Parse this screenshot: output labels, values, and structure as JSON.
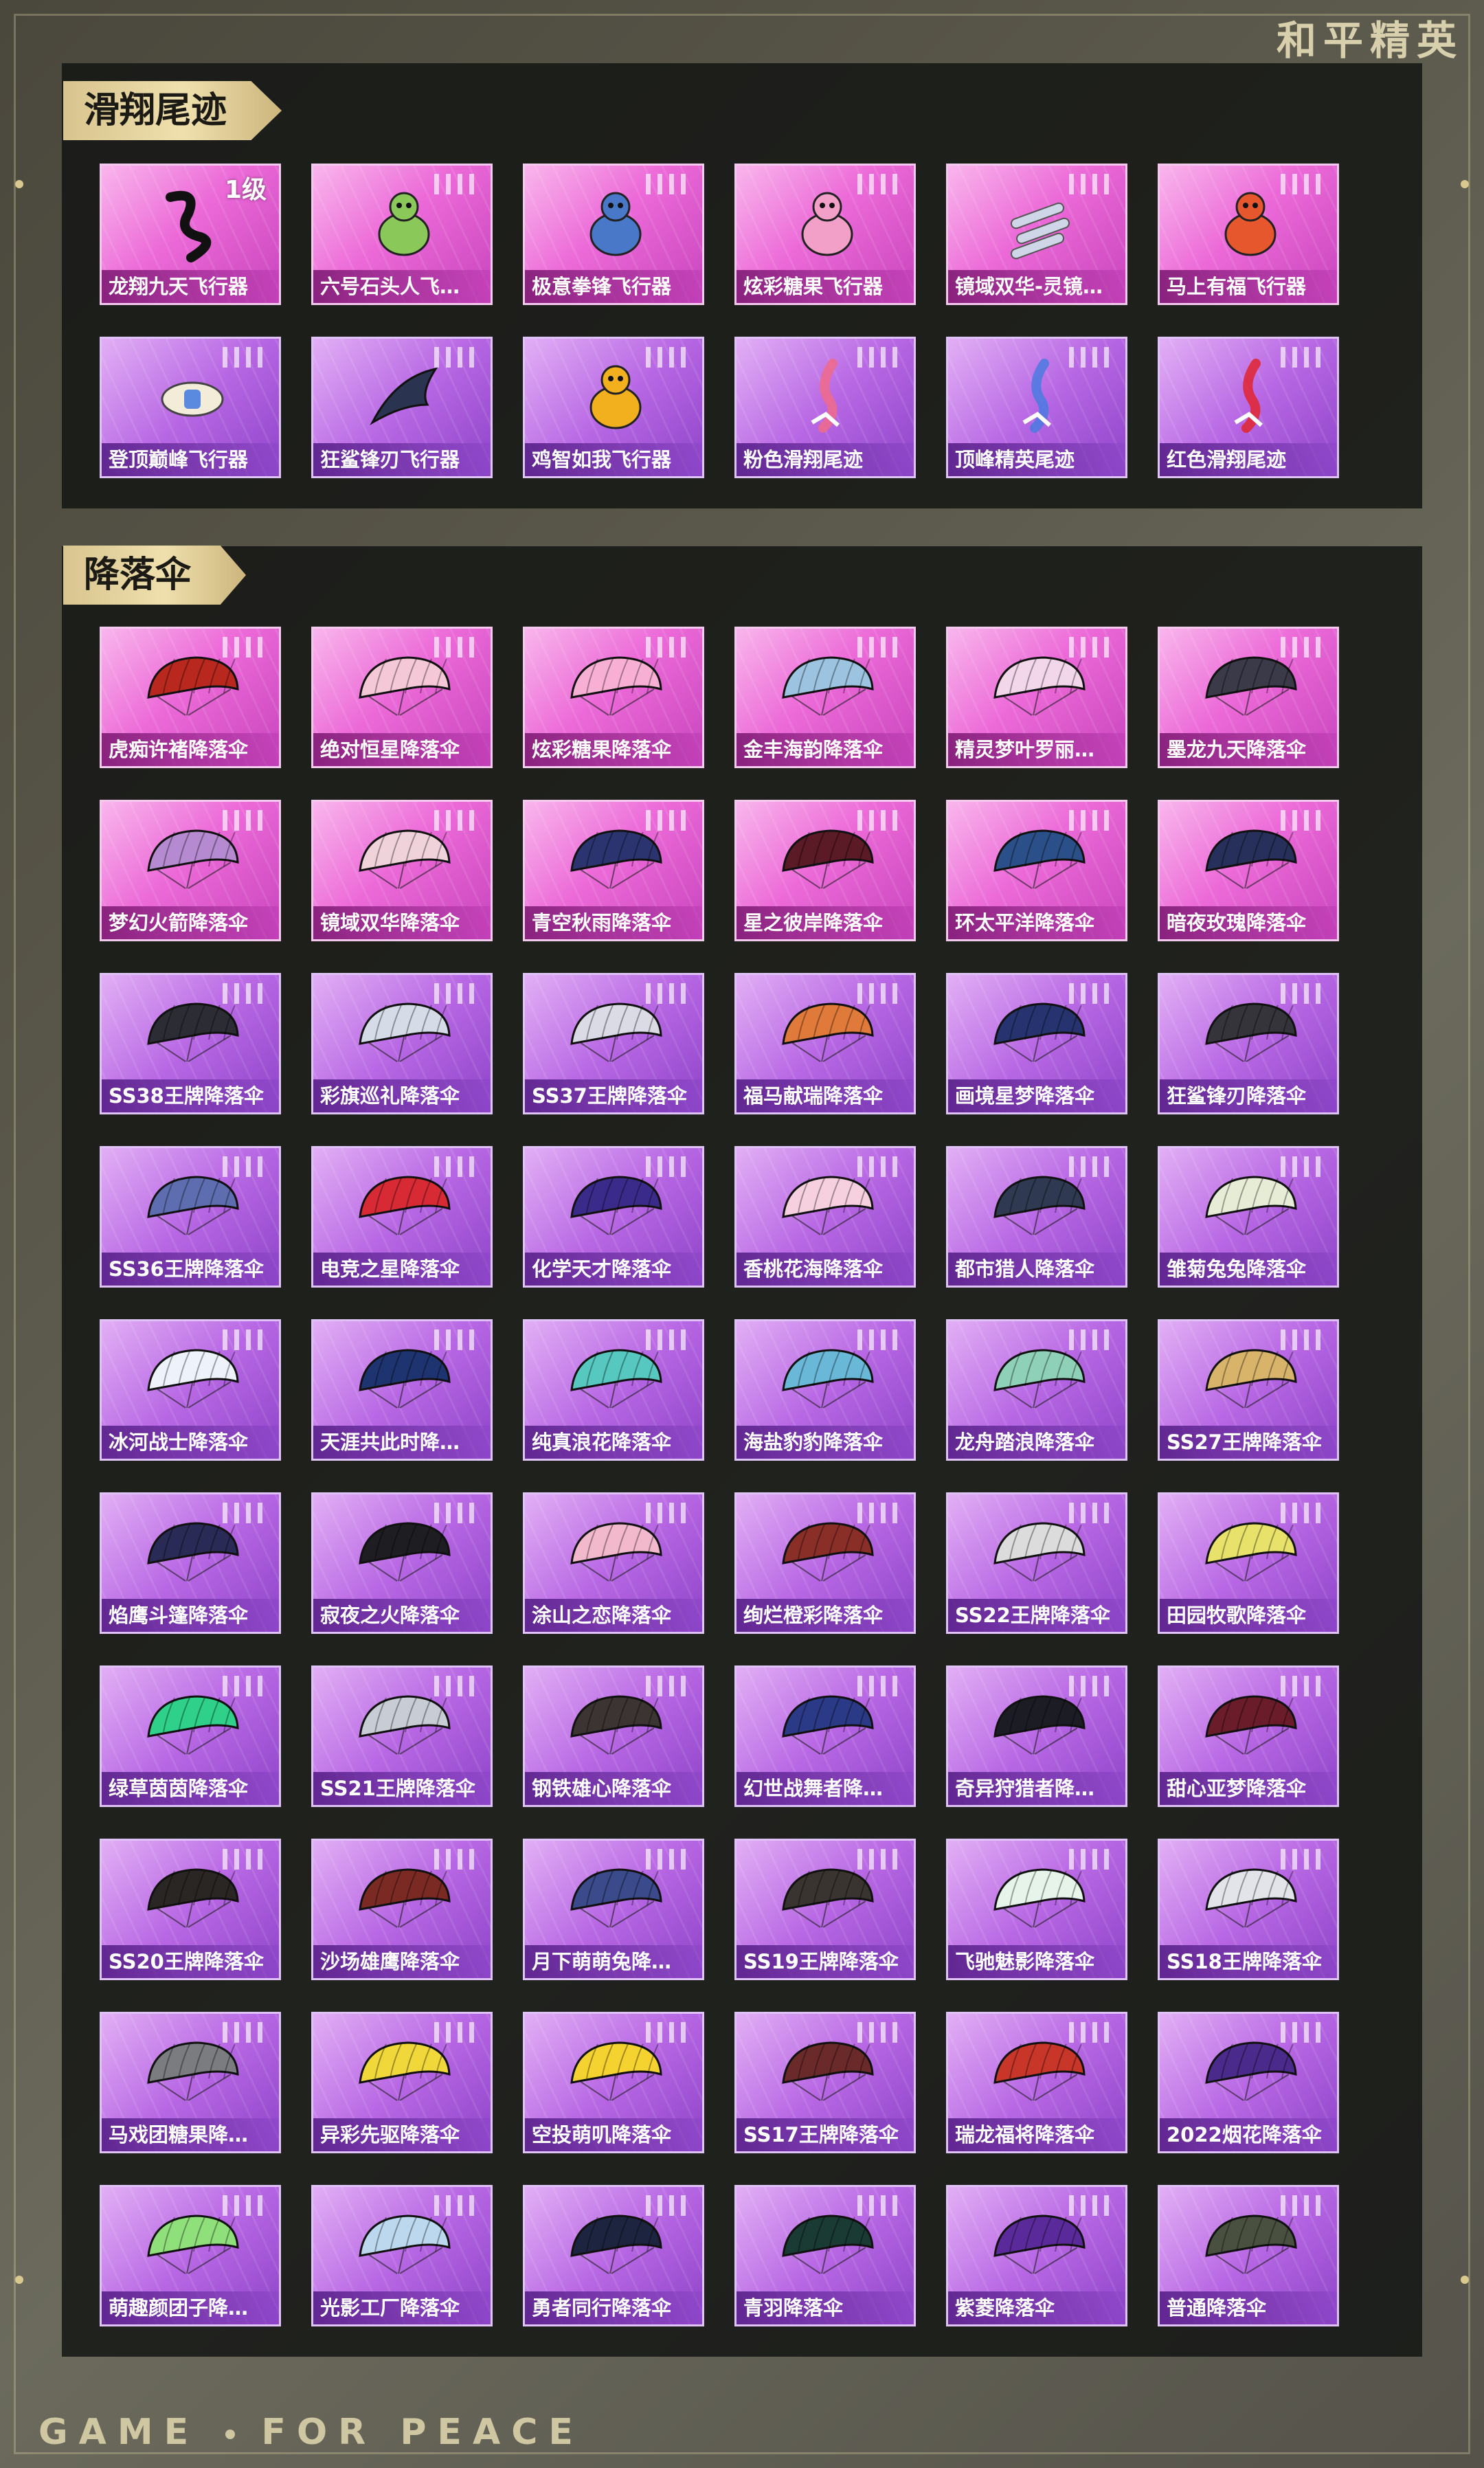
{
  "brand": {
    "top": "和平精英",
    "bottom": [
      "GAME",
      "FOR",
      "PEACE"
    ]
  },
  "sections": {
    "glide": {
      "title": "滑翔尾迹",
      "items": [
        {
          "label": "龙翔九天飞行器",
          "level": "1级",
          "icon": "dragon-glider-icon",
          "style": "pink"
        },
        {
          "label": "六号石头人飞…",
          "icon": "stone-figure-glider-icon",
          "style": "pink"
        },
        {
          "label": "极意拳锋飞行器",
          "icon": "cat-glider-icon",
          "style": "pink"
        },
        {
          "label": "炫彩糖果飞行器",
          "icon": "candy-glider-icon",
          "style": "pink"
        },
        {
          "label": "镜域双华-灵镜…",
          "icon": "blade-glider-icon",
          "style": "pink"
        },
        {
          "label": "马上有福飞行器",
          "icon": "horse-glider-icon",
          "style": "pink"
        },
        {
          "label": "登顶巅峰飞行器",
          "icon": "winged-glider-icon",
          "style": "purple"
        },
        {
          "label": "狂鲨锋刃飞行器",
          "icon": "shark-glider-icon",
          "style": "purple"
        },
        {
          "label": "鸡智如我飞行器",
          "icon": "chicken-glider-icon",
          "style": "purple"
        },
        {
          "label": "粉色滑翔尾迹",
          "icon": "pink-smoke-trail-icon",
          "style": "purple"
        },
        {
          "label": "顶峰精英尾迹",
          "icon": "elite-smoke-trail-icon",
          "style": "purple"
        },
        {
          "label": "红色滑翔尾迹",
          "icon": "red-smoke-trail-icon",
          "style": "purple"
        }
      ]
    },
    "chute": {
      "title": "降落伞",
      "items": [
        {
          "label": "虎痴许褚降落伞",
          "icon": "parachute-icon",
          "style": "pink",
          "canopy": "#b8281f"
        },
        {
          "label": "绝对恒星降落伞",
          "icon": "parachute-icon",
          "style": "pink",
          "canopy": "#f4c8d6"
        },
        {
          "label": "炫彩糖果降落伞",
          "icon": "parachute-icon",
          "style": "pink",
          "canopy": "#f7b0d4"
        },
        {
          "label": "金丰海韵降落伞",
          "icon": "parachute-icon",
          "style": "pink",
          "canopy": "#9cc4e0"
        },
        {
          "label": "精灵梦叶罗丽…",
          "icon": "parachute-icon",
          "style": "pink",
          "canopy": "#f2d6ea"
        },
        {
          "label": "墨龙九天降落伞",
          "icon": "parachute-icon",
          "style": "pink",
          "canopy": "#3a3a48"
        },
        {
          "label": "梦幻火箭降落伞",
          "icon": "parachute-icon",
          "style": "pink",
          "canopy": "#b58ad0"
        },
        {
          "label": "镜域双华降落伞",
          "icon": "parachute-icon",
          "style": "pink",
          "canopy": "#f0d2da"
        },
        {
          "label": "青空秋雨降落伞",
          "icon": "parachute-icon",
          "style": "pink",
          "canopy": "#2c3470"
        },
        {
          "label": "星之彼岸降落伞",
          "icon": "parachute-icon",
          "style": "pink",
          "canopy": "#5a1a26"
        },
        {
          "label": "环太平洋降落伞",
          "icon": "parachute-icon",
          "style": "pink",
          "canopy": "#2b4f88"
        },
        {
          "label": "暗夜玫瑰降落伞",
          "icon": "parachute-icon",
          "style": "pink",
          "canopy": "#26305a"
        },
        {
          "label": "SS38王牌降落伞",
          "icon": "parachute-icon",
          "style": "purple",
          "canopy": "#2c2c34"
        },
        {
          "label": "彩旗巡礼降落伞",
          "icon": "parachute-icon",
          "style": "purple",
          "canopy": "#d6dbe8"
        },
        {
          "label": "SS37王牌降落伞",
          "icon": "parachute-icon",
          "style": "purple",
          "canopy": "#dadbe4"
        },
        {
          "label": "福马献瑞降落伞",
          "icon": "parachute-icon",
          "style": "purple",
          "canopy": "#e07a3a"
        },
        {
          "label": "画境星梦降落伞",
          "icon": "parachute-icon",
          "style": "purple",
          "canopy": "#26336e"
        },
        {
          "label": "狂鲨锋刃降落伞",
          "icon": "parachute-icon",
          "style": "purple",
          "canopy": "#34343a"
        },
        {
          "label": "SS36王牌降落伞",
          "icon": "parachute-icon",
          "style": "purple",
          "canopy": "#5d6db0"
        },
        {
          "label": "电竞之星降落伞",
          "icon": "parachute-icon",
          "style": "purple",
          "canopy": "#d82a34"
        },
        {
          "label": "化学天才降落伞",
          "icon": "parachute-icon",
          "style": "purple",
          "canopy": "#3a2a8a"
        },
        {
          "label": "香桃花海降落伞",
          "icon": "parachute-icon",
          "style": "purple",
          "canopy": "#f6d0de"
        },
        {
          "label": "都市猎人降落伞",
          "icon": "parachute-icon",
          "style": "purple",
          "canopy": "#2f3a52"
        },
        {
          "label": "雏菊兔兔降落伞",
          "icon": "parachute-icon",
          "style": "purple",
          "canopy": "#e6ecd6"
        },
        {
          "label": "冰河战士降落伞",
          "icon": "parachute-icon",
          "style": "purple",
          "canopy": "#eef3fb"
        },
        {
          "label": "天涯共此时降…",
          "icon": "parachute-icon",
          "style": "purple",
          "canopy": "#1e3470"
        },
        {
          "label": "纯真浪花降落伞",
          "icon": "parachute-icon",
          "style": "purple",
          "canopy": "#56c8c0"
        },
        {
          "label": "海盐豹豹降落伞",
          "icon": "parachute-icon",
          "style": "purple",
          "canopy": "#6ab8d8"
        },
        {
          "label": "龙舟踏浪降落伞",
          "icon": "parachute-icon",
          "style": "purple",
          "canopy": "#8fd0b8"
        },
        {
          "label": "SS27王牌降落伞",
          "icon": "parachute-icon",
          "style": "purple",
          "canopy": "#d8b46a"
        },
        {
          "label": "焰鹰斗篷降落伞",
          "icon": "parachute-icon",
          "style": "purple",
          "canopy": "#2a2a56"
        },
        {
          "label": "寂夜之火降落伞",
          "icon": "parachute-icon",
          "style": "purple",
          "canopy": "#1e1e22"
        },
        {
          "label": "涂山之恋降落伞",
          "icon": "parachute-icon",
          "style": "purple",
          "canopy": "#f2b8cc"
        },
        {
          "label": "绚烂橙彩降落伞",
          "icon": "parachute-icon",
          "style": "purple",
          "canopy": "#8a2e28"
        },
        {
          "label": "SS22王牌降落伞",
          "icon": "parachute-icon",
          "style": "purple",
          "canopy": "#dcdcdc"
        },
        {
          "label": "田园牧歌降落伞",
          "icon": "parachute-icon",
          "style": "purple",
          "canopy": "#e8e26a"
        },
        {
          "label": "绿草茵茵降落伞",
          "icon": "parachute-icon",
          "style": "purple",
          "canopy": "#2ed08a"
        },
        {
          "label": "SS21王牌降落伞",
          "icon": "parachute-icon",
          "style": "purple",
          "canopy": "#c8ccd4"
        },
        {
          "label": "钢铁雄心降落伞",
          "icon": "parachute-icon",
          "style": "purple",
          "canopy": "#3c3432"
        },
        {
          "label": "幻世战舞者降…",
          "icon": "parachute-icon",
          "style": "purple",
          "canopy": "#2a3a86"
        },
        {
          "label": "奇异狩猎者降…",
          "icon": "parachute-icon",
          "style": "purple",
          "canopy": "#1c1c24"
        },
        {
          "label": "甜心亚梦降落伞",
          "icon": "parachute-icon",
          "style": "purple",
          "canopy": "#6a1c2a"
        },
        {
          "label": "SS20王牌降落伞",
          "icon": "parachute-icon",
          "style": "purple",
          "canopy": "#2a2624"
        },
        {
          "label": "沙场雄鹰降落伞",
          "icon": "parachute-icon",
          "style": "purple",
          "canopy": "#7a2a22"
        },
        {
          "label": "月下萌萌兔降…",
          "icon": "parachute-icon",
          "style": "purple",
          "canopy": "#3a4a8a"
        },
        {
          "label": "SS19王牌降落伞",
          "icon": "parachute-icon",
          "style": "purple",
          "canopy": "#3a3430"
        },
        {
          "label": "飞驰魅影降落伞",
          "icon": "parachute-icon",
          "style": "purple",
          "canopy": "#e6f4ea"
        },
        {
          "label": "SS18王牌降落伞",
          "icon": "parachute-icon",
          "style": "purple",
          "canopy": "#e2e4ea"
        },
        {
          "label": "马戏团糖果降…",
          "icon": "parachute-icon",
          "style": "purple",
          "canopy": "#7a7c80"
        },
        {
          "label": "异彩先驱降落伞",
          "icon": "parachute-icon",
          "style": "purple",
          "canopy": "#f0d83a"
        },
        {
          "label": "空投萌叽降落伞",
          "icon": "parachute-icon",
          "style": "purple",
          "canopy": "#f4d230"
        },
        {
          "label": "SS17王牌降落伞",
          "icon": "parachute-icon",
          "style": "purple",
          "canopy": "#6a2a2a"
        },
        {
          "label": "瑞龙福将降落伞",
          "icon": "parachute-icon",
          "style": "purple",
          "canopy": "#c8362a"
        },
        {
          "label": "2022烟花降落伞",
          "icon": "parachute-icon",
          "style": "purple",
          "canopy": "#4a2a8a"
        },
        {
          "label": "萌趣颜团子降…",
          "icon": "parachute-icon",
          "style": "purple",
          "canopy": "#8fe07a"
        },
        {
          "label": "光影工厂降落伞",
          "icon": "parachute-icon",
          "style": "purple",
          "canopy": "#bcd8ee"
        },
        {
          "label": "勇者同行降落伞",
          "icon": "parachute-icon",
          "style": "purple",
          "canopy": "#1c2440"
        },
        {
          "label": "青羽降落伞",
          "icon": "parachute-icon",
          "style": "purple",
          "canopy": "#1a3a34"
        },
        {
          "label": "紫菱降落伞",
          "icon": "parachute-icon",
          "style": "purple",
          "canopy": "#5a2a9a"
        },
        {
          "label": "普通降落伞",
          "icon": "parachute-icon",
          "style": "purple",
          "canopy": "#4a5040"
        }
      ]
    }
  }
}
